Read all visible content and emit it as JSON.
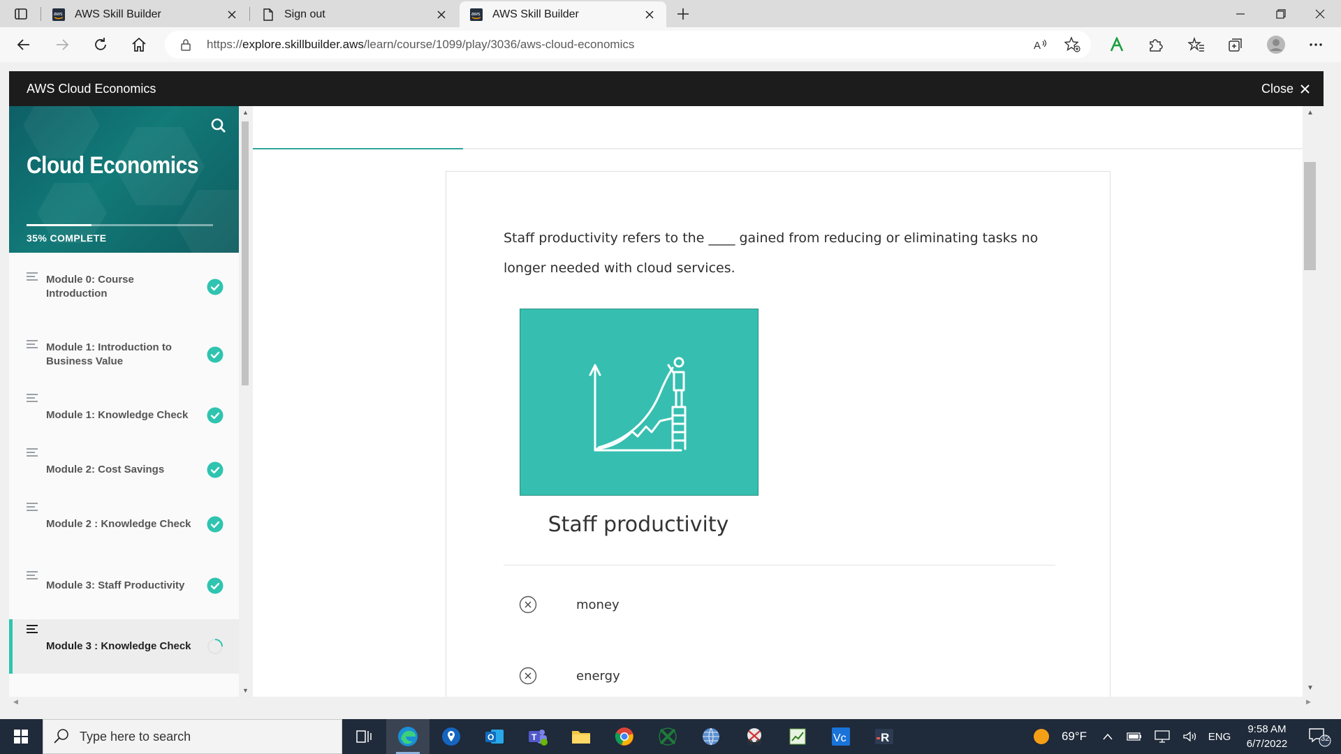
{
  "browser": {
    "tabs": [
      {
        "title": "AWS Skill Builder",
        "favicon": "aws-logo-icon",
        "active": false
      },
      {
        "title": "Sign out",
        "favicon": "page-icon",
        "active": false
      },
      {
        "title": "AWS Skill Builder",
        "favicon": "aws-logo-icon",
        "active": true
      }
    ],
    "url_prefix": "https://",
    "url_host": "explore.skillbuilder.aws",
    "url_path": "/learn/course/1099/play/3036/aws-cloud-economics"
  },
  "course": {
    "header_title": "AWS Cloud Economics",
    "close_label": "Close"
  },
  "sidebar": {
    "title": "Cloud Economics",
    "progress_percent": 35,
    "progress_label": "35% COMPLETE",
    "items": [
      {
        "label": "Module 0: Course Introduction",
        "status": "complete"
      },
      {
        "label": "Module 1: Introduction to Business Value",
        "status": "complete"
      },
      {
        "label": "Module 1: Knowledge Check",
        "status": "complete"
      },
      {
        "label": "Module 2: Cost Savings",
        "status": "complete"
      },
      {
        "label": "Module 2 : Knowledge Check",
        "status": "complete"
      },
      {
        "label": "Module 3: Staff Productivity",
        "status": "complete"
      },
      {
        "label": "Module 3 : Knowledge Check",
        "status": "in-progress"
      }
    ]
  },
  "lesson": {
    "top_progress_fraction": 0.2,
    "question": "Staff productivity refers to the ____ gained from reducing or eliminating  tasks no longer needed with cloud services.",
    "image_caption": "Staff productivity",
    "options": [
      {
        "label": "money"
      },
      {
        "label": "energy"
      }
    ]
  },
  "taskbar": {
    "search_placeholder": "Type here to search",
    "weather": "69°F",
    "language": "ENG",
    "time": "9:58 AM",
    "date": "6/7/2022",
    "notification_count": "32"
  },
  "colors": {
    "accent_teal": "#2ec4b0",
    "hero_teal": "#127a78",
    "image_teal": "#36bfb0",
    "header_dark": "#1c1c1c",
    "taskbar": "#1f2a3a"
  }
}
